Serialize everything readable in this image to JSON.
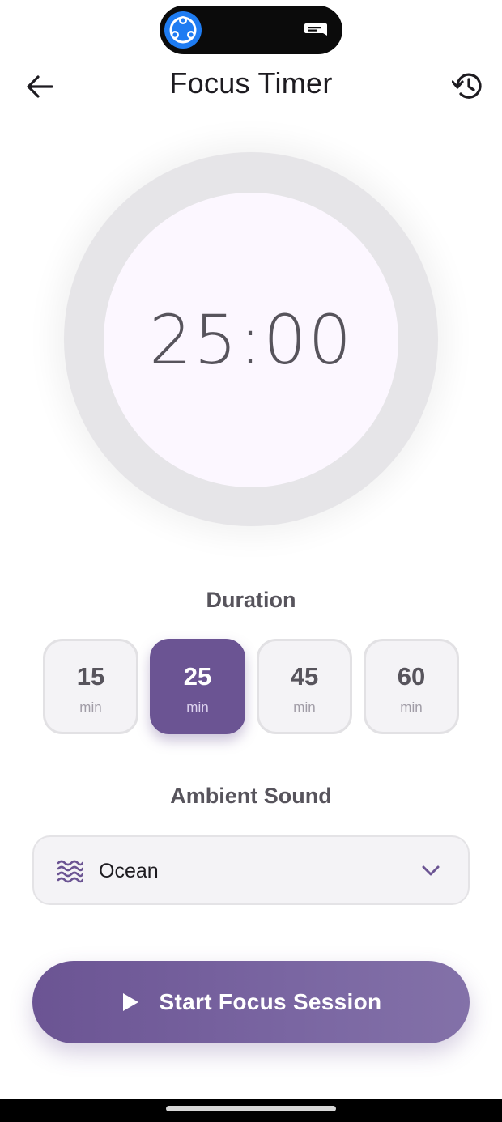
{
  "header": {
    "title": "Focus Timer",
    "back_icon": "arrow-left-icon",
    "history_icon": "history-icon"
  },
  "timer": {
    "display": "25:00"
  },
  "duration": {
    "label": "Duration",
    "options": [
      {
        "value": "15",
        "unit": "min",
        "selected": false
      },
      {
        "value": "25",
        "unit": "min",
        "selected": true
      },
      {
        "value": "45",
        "unit": "min",
        "selected": false
      },
      {
        "value": "60",
        "unit": "min",
        "selected": false
      }
    ]
  },
  "ambient": {
    "label": "Ambient Sound",
    "selected": "Ocean",
    "icon": "waves-icon"
  },
  "cta": {
    "label": "Start Focus Session",
    "icon": "play-icon"
  },
  "colors": {
    "accent": "#6b5493",
    "timer_ring": "#e6e5e8",
    "timer_face": "#fcf7ff"
  }
}
